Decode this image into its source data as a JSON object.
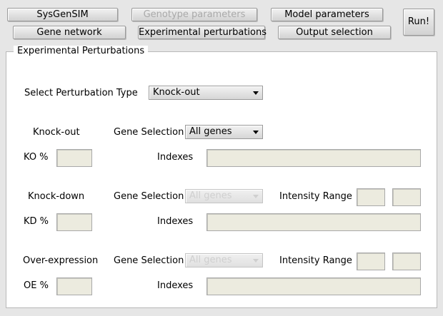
{
  "toolbar": {
    "sysgensim": "SysGenSIM",
    "genotype_parameters": "Genotype parameters",
    "model_parameters": "Model parameters",
    "gene_network": "Gene network",
    "experimental_perturbations": "Experimental perturbations",
    "output_selection": "Output selection",
    "run": "Run!"
  },
  "panel": {
    "title": "Experimental Perturbations",
    "perturbation_type_label": "Select Perturbation Type",
    "perturbation_type_value": "Knock-out",
    "knockout": {
      "title": "Knock-out",
      "gene_selection_label": "Gene Selection",
      "gene_selection_value": "All genes",
      "percent_label": "KO %",
      "percent_value": "",
      "indexes_label": "Indexes",
      "indexes_value": ""
    },
    "knockdown": {
      "title": "Knock-down",
      "gene_selection_label": "Gene Selection",
      "gene_selection_value": "All genes",
      "intensity_label": "Intensity Range",
      "intensity_min": "",
      "intensity_max": "",
      "percent_label": "KD %",
      "percent_value": "",
      "indexes_label": "Indexes",
      "indexes_value": ""
    },
    "overexpression": {
      "title": "Over-expression",
      "gene_selection_label": "Gene Selection",
      "gene_selection_value": "All genes",
      "intensity_label": "Intensity Range",
      "intensity_min": "",
      "intensity_max": "",
      "percent_label": "OE %",
      "percent_value": "",
      "indexes_label": "Indexes",
      "indexes_value": ""
    }
  }
}
